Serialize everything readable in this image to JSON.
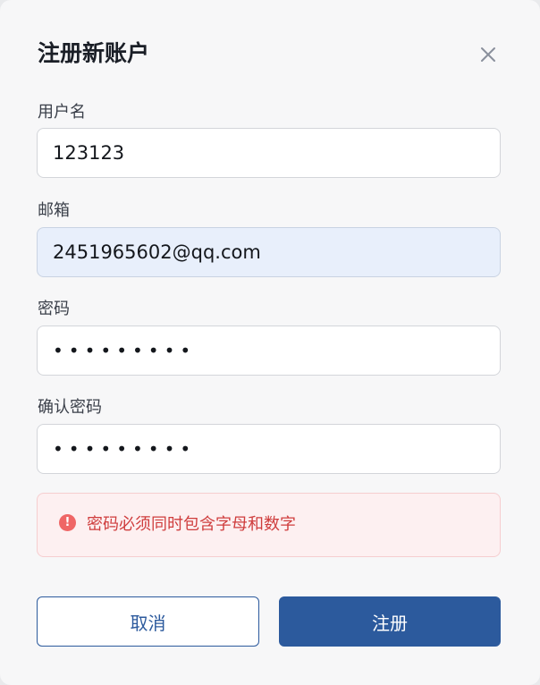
{
  "dialog": {
    "title": "注册新账户",
    "close_icon": "close-icon"
  },
  "form": {
    "username": {
      "label": "用户名",
      "value": "123123"
    },
    "email": {
      "label": "邮箱",
      "value": "2451965602@qq.com"
    },
    "password": {
      "label": "密码",
      "value": "•••••••••"
    },
    "confirm_password": {
      "label": "确认密码",
      "value": "•••••••••"
    }
  },
  "error": {
    "icon": "error-circle-icon",
    "message": "密码必须同时包含字母和数字"
  },
  "actions": {
    "cancel_label": "取消",
    "submit_label": "注册"
  },
  "colors": {
    "primary": "#2c5a9d",
    "error_text": "#cf3d3d",
    "error_bg": "#fdf0f1",
    "autofill_bg": "#e8effb"
  }
}
